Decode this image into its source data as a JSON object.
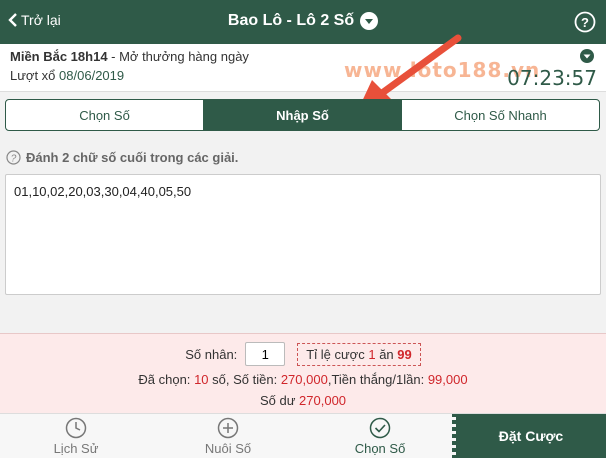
{
  "header": {
    "back_label": "Trở lại",
    "title": "Bao Lô - Lô 2 Số"
  },
  "info": {
    "region": "Miền Bắc 18h14",
    "region_sub": " - Mở thưởng hàng ngày",
    "draw_label": "Lượt xổ",
    "draw_date": "08/06/2019",
    "countdown": "07:23:57",
    "watermark": "www.loto188.vn"
  },
  "tabs": [
    {
      "label": "Chọn Số",
      "active": false
    },
    {
      "label": "Nhập Số",
      "active": true
    },
    {
      "label": "Chọn Số Nhanh",
      "active": false
    }
  ],
  "hint": "Đánh 2 chữ số cuối trong các giải.",
  "numbers_value": "01,10,02,20,03,30,04,40,05,50",
  "summary": {
    "multiplier_label": "Số nhân:",
    "multiplier_value": "1",
    "ratio_prefix": "Tỉ lệ cược",
    "ratio_a": "1",
    "ratio_mid": "ăn",
    "ratio_b": "99",
    "chosen_label": "Đã chọn:",
    "chosen_count": "10",
    "chosen_unit": "số, Số tiền:",
    "amount": "270,000",
    "win_label": ",Tiền thắng/1lần:",
    "win_amount": "99,000",
    "balance_label": "Số dư",
    "balance": "270,000"
  },
  "bottom_nav": [
    {
      "label": "Lịch Sử",
      "icon": "clock-icon"
    },
    {
      "label": "Nuôi Số",
      "icon": "plus-circle-icon"
    },
    {
      "label": "Chọn Số",
      "icon": "check-circle-icon"
    }
  ],
  "bet_button": "Đặt Cược",
  "colors": {
    "primary": "#2f5a48",
    "accent_red": "#d0262b",
    "summary_bg": "#fdeaea"
  }
}
